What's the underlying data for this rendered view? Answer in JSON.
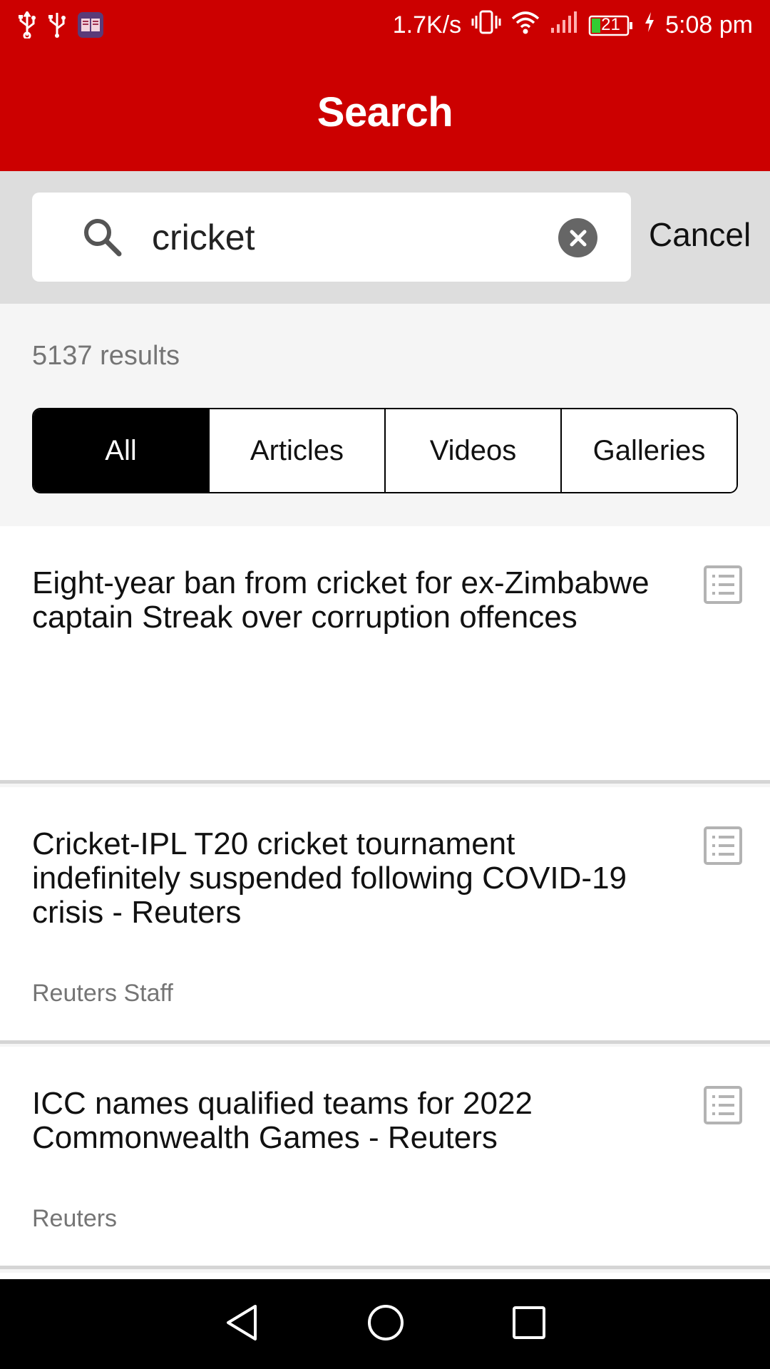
{
  "status_bar": {
    "net_speed": "1.7K/s",
    "battery_level": "21",
    "time": "5:08 pm"
  },
  "header": {
    "title": "Search"
  },
  "search": {
    "query": "cricket",
    "cancel_label": "Cancel"
  },
  "results_count": "5137 results",
  "filters": {
    "all": "All",
    "articles": "Articles",
    "videos": "Videos",
    "galleries": "Galleries",
    "active": "All"
  },
  "results": [
    {
      "headline": "Eight-year ban from cricket for ex-Zimbabwe captain Streak over corruption offences",
      "byline": ""
    },
    {
      "headline": "Cricket-IPL T20 cricket tournament indefinitely suspended following COVID-19 crisis - Reuters",
      "byline": "Reuters Staff"
    },
    {
      "headline": "ICC names qualified teams for 2022 Commonwealth Games - Reuters",
      "byline": "Reuters"
    }
  ],
  "colors": {
    "brand_red": "#cc0000",
    "active_tab": "#000000",
    "muted_text": "#757575"
  },
  "icons": [
    "usb-icon",
    "usb-icon",
    "book-app-icon",
    "vibrate-icon",
    "wifi-icon",
    "signal-icon",
    "battery-icon",
    "charging-icon",
    "search-icon",
    "clear-icon",
    "article-list-icon",
    "back-nav-icon",
    "home-nav-icon",
    "recents-nav-icon"
  ]
}
